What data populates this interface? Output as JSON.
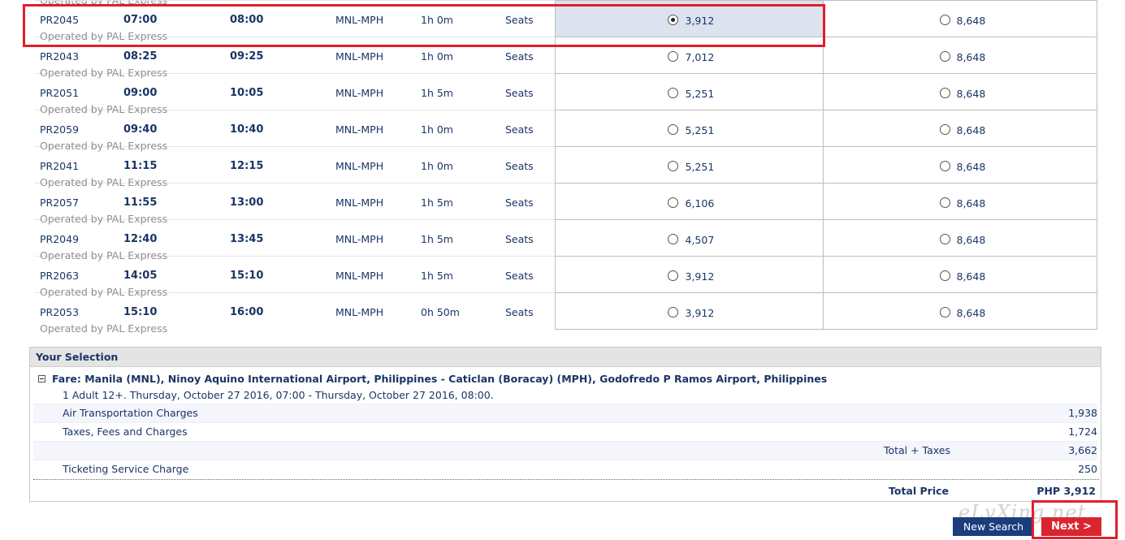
{
  "cut_off_text": "Operated by PAL Express",
  "flights": [
    {
      "flight": "PR2045",
      "depart": "07:00",
      "arrive": "08:00",
      "route": "MNL-MPH",
      "duration": "1h 0m",
      "seats": "Seats",
      "operator": "Operated by PAL Express",
      "economy_price": "3,912",
      "business_price": "8,648",
      "economy_selected": true
    },
    {
      "flight": "PR2043",
      "depart": "08:25",
      "arrive": "09:25",
      "route": "MNL-MPH",
      "duration": "1h 0m",
      "seats": "Seats",
      "operator": "Operated by PAL Express",
      "economy_price": "7,012",
      "business_price": "8,648",
      "economy_selected": false
    },
    {
      "flight": "PR2051",
      "depart": "09:00",
      "arrive": "10:05",
      "route": "MNL-MPH",
      "duration": "1h 5m",
      "seats": "Seats",
      "operator": "Operated by PAL Express",
      "economy_price": "5,251",
      "business_price": "8,648",
      "economy_selected": false
    },
    {
      "flight": "PR2059",
      "depart": "09:40",
      "arrive": "10:40",
      "route": "MNL-MPH",
      "duration": "1h 0m",
      "seats": "Seats",
      "operator": "Operated by PAL Express",
      "economy_price": "5,251",
      "business_price": "8,648",
      "economy_selected": false
    },
    {
      "flight": "PR2041",
      "depart": "11:15",
      "arrive": "12:15",
      "route": "MNL-MPH",
      "duration": "1h 0m",
      "seats": "Seats",
      "operator": "Operated by PAL Express",
      "economy_price": "5,251",
      "business_price": "8,648",
      "economy_selected": false
    },
    {
      "flight": "PR2057",
      "depart": "11:55",
      "arrive": "13:00",
      "route": "MNL-MPH",
      "duration": "1h 5m",
      "seats": "Seats",
      "operator": "Operated by PAL Express",
      "economy_price": "6,106",
      "business_price": "8,648",
      "economy_selected": false
    },
    {
      "flight": "PR2049",
      "depart": "12:40",
      "arrive": "13:45",
      "route": "MNL-MPH",
      "duration": "1h 5m",
      "seats": "Seats",
      "operator": "Operated by PAL Express",
      "economy_price": "4,507",
      "business_price": "8,648",
      "economy_selected": false
    },
    {
      "flight": "PR2063",
      "depart": "14:05",
      "arrive": "15:10",
      "route": "MNL-MPH",
      "duration": "1h 5m",
      "seats": "Seats",
      "operator": "Operated by PAL Express",
      "economy_price": "3,912",
      "business_price": "8,648",
      "economy_selected": false
    },
    {
      "flight": "PR2053",
      "depart": "15:10",
      "arrive": "16:00",
      "route": "MNL-MPH",
      "duration": "0h 50m",
      "seats": "Seats",
      "operator": "Operated by PAL Express",
      "economy_price": "3,912",
      "business_price": "8,648",
      "economy_selected": false
    }
  ],
  "selection": {
    "title": "Your Selection",
    "fare_heading": "Fare: Manila (MNL), Ninoy Aquino International Airport, Philippines - Caticlan (Boracay) (MPH), Godofredo P Ramos Airport, Philippines",
    "passenger_line": "1 Adult 12+. Thursday, October 27 2016, 07:00 - Thursday, October 27 2016, 08:00.",
    "air_label": "Air Transportation Charges",
    "air_value": "1,938",
    "taxes_label": "Taxes, Fees and Charges",
    "taxes_value": "1,724",
    "subtotal_label": "Total + Taxes",
    "subtotal_value": "3,662",
    "service_label": "Ticketing Service Charge",
    "service_value": "250",
    "total_label": "Total Price",
    "total_value": "PHP 3,912"
  },
  "buttons": {
    "new_search": "New Search",
    "next": "Next >"
  },
  "watermark": "eLvXing.net",
  "colors": {
    "accent_blue": "#1b3d7e",
    "next_red": "#d9252e",
    "highlight_red": "#e01e2b",
    "selected_cell": "#dde2ef"
  }
}
